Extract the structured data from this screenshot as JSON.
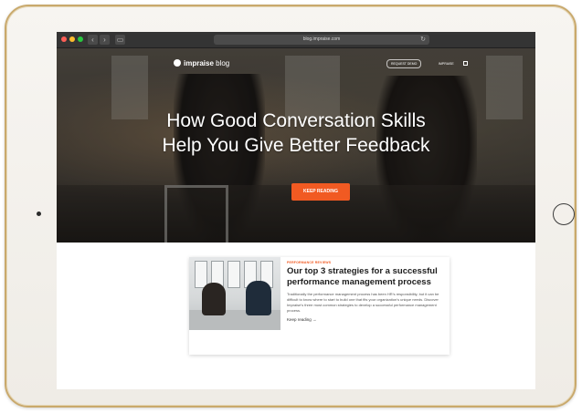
{
  "browser": {
    "address": "blog.impraise.com",
    "back_glyph": "‹",
    "forward_glyph": "›",
    "sidebar_glyph": "▭",
    "reload_glyph": "↻"
  },
  "site": {
    "logo_bold": "impraise",
    "logo_light": " blog",
    "nav_pill_label": "REQUEST DEMO",
    "nav_link_label": "IMPRAISE"
  },
  "hero": {
    "title_line1": "How Good Conversation Skills",
    "title_line2": "Help You Give Better Feedback",
    "cta_label": "KEEP READING"
  },
  "article": {
    "tag": "PERFORMANCE REVIEWS",
    "title": "Our top 3 strategies for a successful performance management process",
    "excerpt": "Traditionally the performance management process has been HR's responsibility, but it can be difficult to know where to start to build one that fits your organization's unique needs. Discover Impraise's three most common strategies to develop a successful performance management process.",
    "more": "Keep reading →"
  },
  "colors": {
    "accent": "#f15a22",
    "tablet_bezel": "#c9a96c"
  }
}
